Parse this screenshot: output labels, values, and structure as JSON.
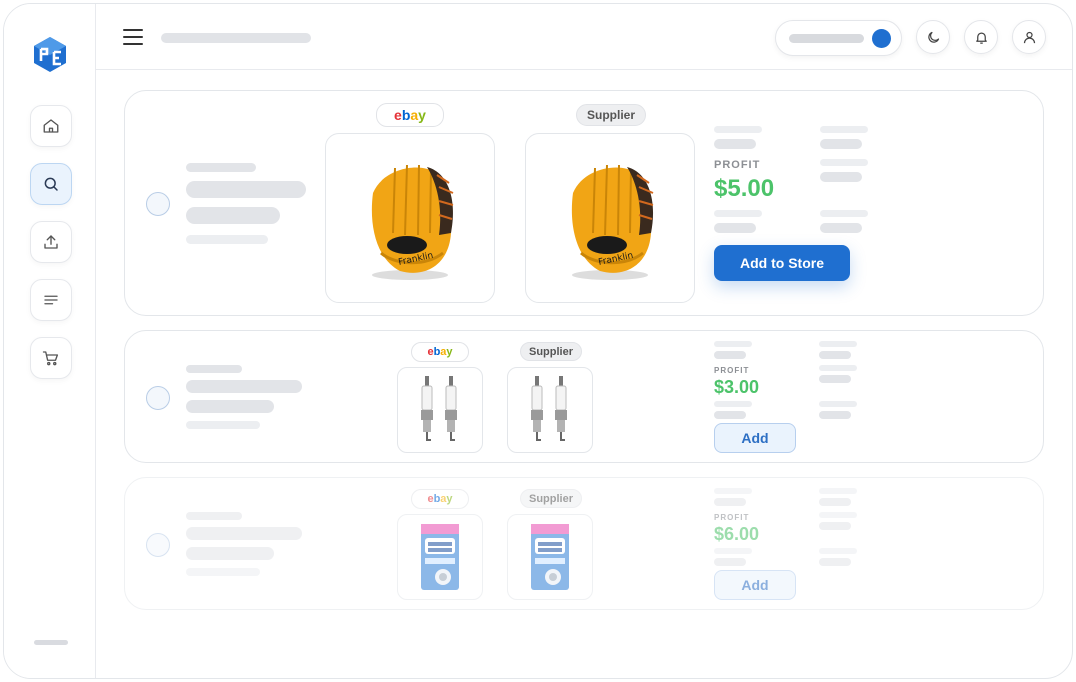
{
  "sidebar": {
    "logo": "box-logo-icon",
    "items": [
      {
        "name": "home",
        "icon": "home-icon"
      },
      {
        "name": "search",
        "icon": "search-icon",
        "active": true
      },
      {
        "name": "upload",
        "icon": "upload-icon"
      },
      {
        "name": "list",
        "icon": "list-icon"
      },
      {
        "name": "cart",
        "icon": "cart-icon"
      }
    ]
  },
  "header": {
    "menu_icon": "hamburger-icon",
    "toggle_color": "#1f6fd0",
    "icons": [
      "moon-icon",
      "bell-icon",
      "user-icon"
    ]
  },
  "products": [
    {
      "ebay_badge": "ebay",
      "supplier_badge": "Supplier",
      "image": "baseball-glove",
      "profit_label": "PROFIT",
      "profit_value": "$5.00",
      "action_label": "Add to Store"
    },
    {
      "ebay_badge": "ebay",
      "supplier_badge": "Supplier",
      "image": "spark-plugs",
      "profit_label": "PROFIT",
      "profit_value": "$3.00",
      "action_label": "Add"
    },
    {
      "ebay_badge": "ebay",
      "supplier_badge": "Supplier",
      "image": "oxiclean-box",
      "profit_label": "PROFIT",
      "profit_value": "$6.00",
      "action_label": "Add"
    }
  ],
  "colors": {
    "accent": "#1f6fd0",
    "profit": "#4cc36a",
    "ebay_e": "#e53238",
    "ebay_b": "#0064d2",
    "ebay_a": "#f5af02",
    "ebay_y": "#86b817"
  }
}
